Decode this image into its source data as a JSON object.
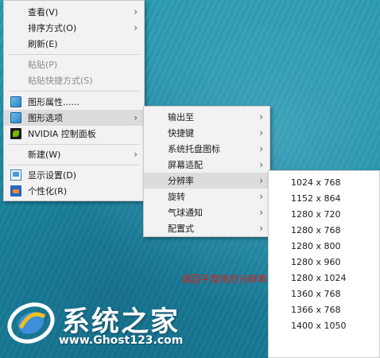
{
  "desktop_menu": {
    "items": [
      {
        "label": "查看(V)",
        "submenu": true
      },
      {
        "label": "排序方式(O)",
        "submenu": true
      },
      {
        "label": "刷新(E)"
      },
      {
        "label": "粘贴(P)",
        "disabled": true
      },
      {
        "label": "粘贴快捷方式(S)",
        "disabled": true
      },
      {
        "label": "图形属性......",
        "icon": "graphics-icon"
      },
      {
        "label": "图形选项",
        "icon": "graphics-icon",
        "submenu": true
      },
      {
        "label": "NVIDIA 控制面板",
        "icon": "nvidia-icon"
      },
      {
        "label": "新建(W)",
        "submenu": true
      },
      {
        "label": "显示设置(D)",
        "icon": "display-settings-icon"
      },
      {
        "label": "个性化(R)",
        "icon": "personalize-icon"
      }
    ],
    "arrow": "›"
  },
  "graphics_options_menu": {
    "items": [
      {
        "label": "输出至",
        "submenu": true
      },
      {
        "label": "快捷键",
        "submenu": true
      },
      {
        "label": "系统托盘图标",
        "submenu": true
      },
      {
        "label": "屏幕适配",
        "submenu": true
      },
      {
        "label": "分辨率",
        "submenu": true
      },
      {
        "label": "旋转",
        "submenu": true
      },
      {
        "label": "气球通知",
        "submenu": true
      },
      {
        "label": "配置式",
        "submenu": true
      }
    ]
  },
  "resolution_menu": {
    "items": [
      "1024 x 768",
      "1152 x 864",
      "1280 x 720",
      "1280 x 768",
      "1280 x 800",
      "1280 x 960",
      "1280 x 1024",
      "1360 x 768",
      "1366 x 768",
      "1400 x 1050"
    ]
  },
  "annotation": "调回平常用的分辨率",
  "watermark": {
    "title": "系统之家",
    "url": "www.Ghost123.com"
  },
  "colors": {
    "desktop": "#1e8ea8",
    "menu_bg": "#f2f2f2",
    "highlight": "#dcdcdc",
    "annotation": "#d4211f"
  }
}
